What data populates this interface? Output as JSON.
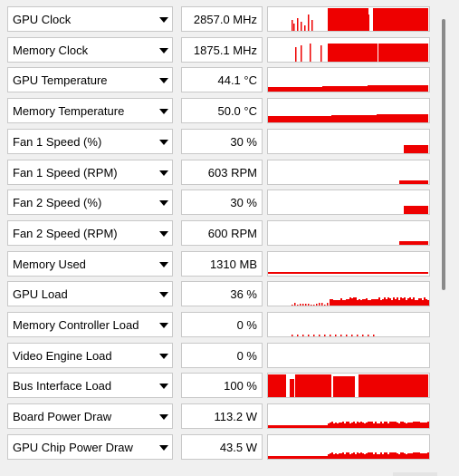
{
  "accent_color": "#ee0000",
  "sensors": [
    {
      "name": "GPU Clock",
      "value": "2857.0 MHz",
      "graph": "gpu_clock"
    },
    {
      "name": "Memory Clock",
      "value": "1875.1 MHz",
      "graph": "mem_clock"
    },
    {
      "name": "GPU Temperature",
      "value": "44.1 °C",
      "graph": "gpu_temp"
    },
    {
      "name": "Memory Temperature",
      "value": "50.0 °C",
      "graph": "mem_temp"
    },
    {
      "name": "Fan 1 Speed (%)",
      "value": "30 %",
      "graph": "fan_small"
    },
    {
      "name": "Fan 1 Speed (RPM)",
      "value": "603 RPM",
      "graph": "fan_thin"
    },
    {
      "name": "Fan 2 Speed (%)",
      "value": "30 %",
      "graph": "fan_small"
    },
    {
      "name": "Fan 2 Speed (RPM)",
      "value": "600 RPM",
      "graph": "fan_thin"
    },
    {
      "name": "Memory Used",
      "value": "1310 MB",
      "graph": "mem_used"
    },
    {
      "name": "GPU Load",
      "value": "36 %",
      "graph": "gpu_load"
    },
    {
      "name": "Memory Controller Load",
      "value": "0 %",
      "graph": "mc_load"
    },
    {
      "name": "Video Engine Load",
      "value": "0 %",
      "graph": "empty"
    },
    {
      "name": "Bus Interface Load",
      "value": "100 %",
      "graph": "bus_load"
    },
    {
      "name": "Board Power Draw",
      "value": "113.2 W",
      "graph": "power"
    },
    {
      "name": "GPU Chip Power Draw",
      "value": "43.5 W",
      "graph": "power"
    }
  ],
  "icons": {
    "dropdown": "dropdown-arrow-icon"
  }
}
